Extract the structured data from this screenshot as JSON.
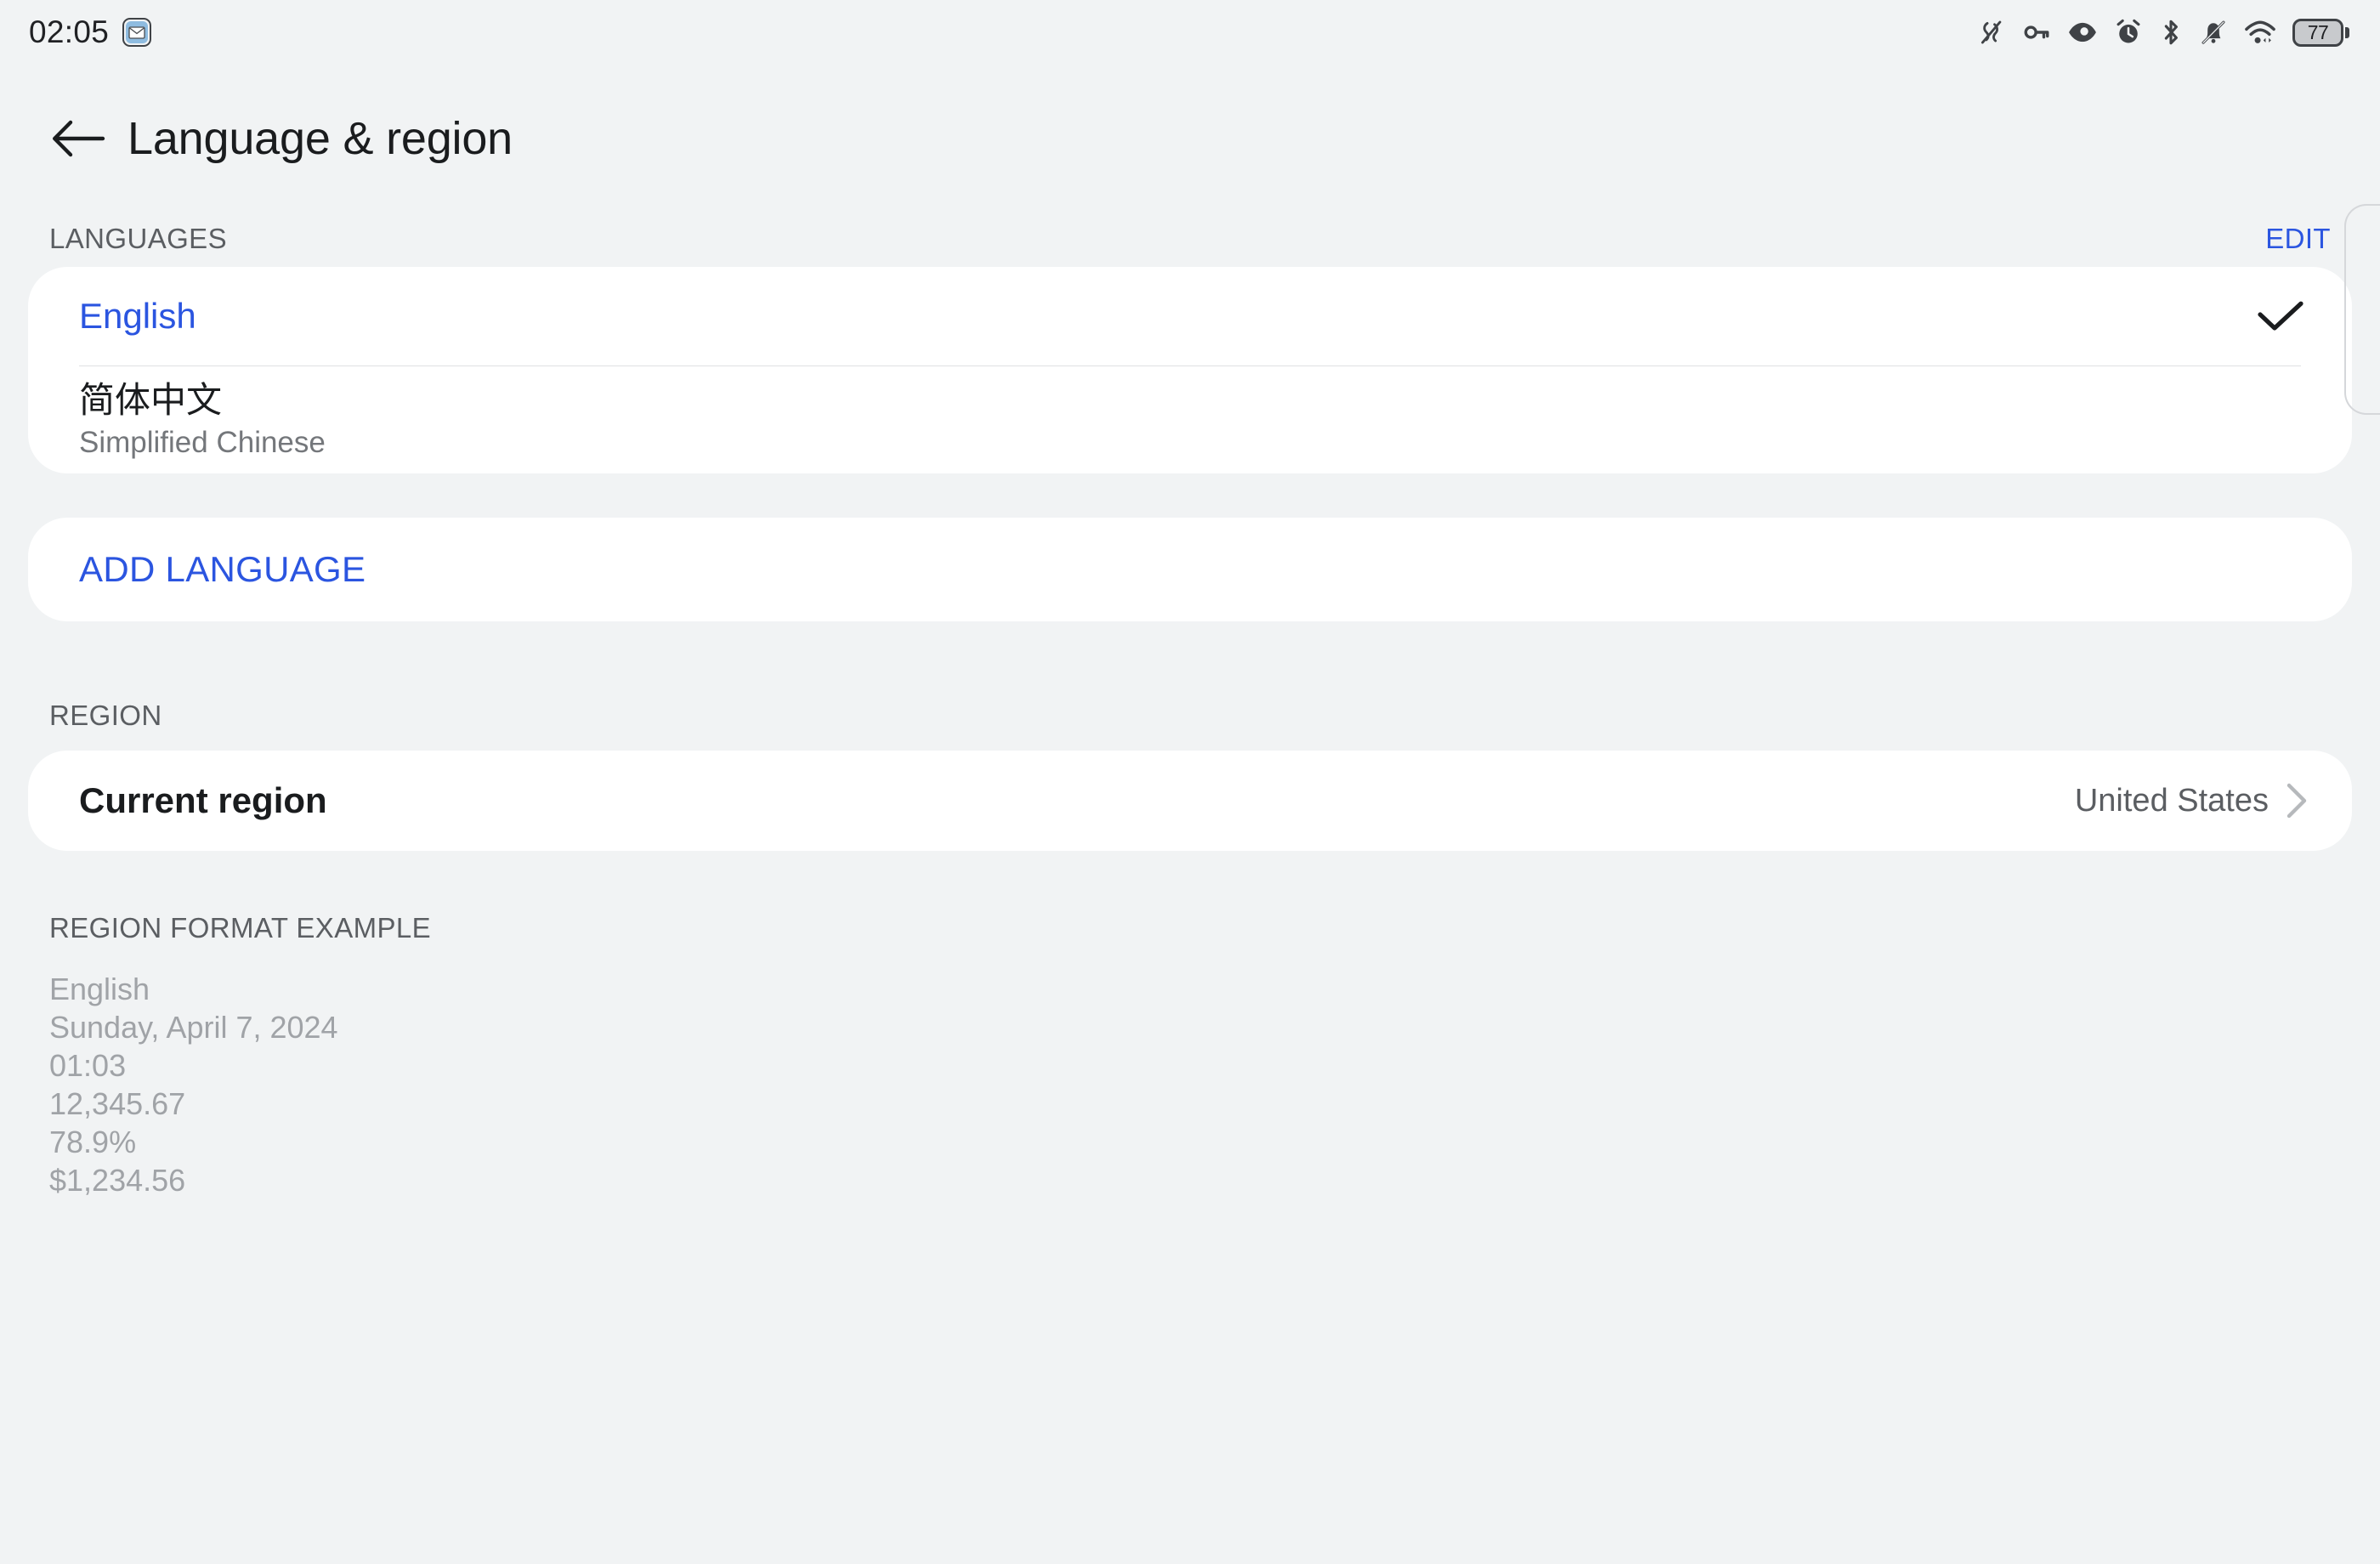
{
  "status_bar": {
    "time": "02:05",
    "notification_icon": "mail-envelope-icon",
    "icons": [
      "nfc-off-icon",
      "vpn-key-icon",
      "eye-comfort-icon",
      "alarm-clock-icon",
      "bluetooth-icon",
      "notifications-silenced-icon",
      "wifi-icon"
    ],
    "battery_level": "77"
  },
  "header": {
    "back_icon": "arrow-left-icon",
    "title": "Language & region"
  },
  "languages_section": {
    "label": "LANGUAGES",
    "edit_label": "EDIT",
    "items": [
      {
        "name": "English",
        "subtitle": "",
        "selected": true,
        "check_icon": "check-icon"
      },
      {
        "name": "简体中文",
        "subtitle": "Simplified Chinese",
        "selected": false
      }
    ],
    "add_language_label": "ADD LANGUAGE"
  },
  "region_section": {
    "label": "REGION",
    "row_title": "Current region",
    "row_value": "United States",
    "chevron_icon": "chevron-right-icon"
  },
  "format_section": {
    "label": "REGION FORMAT EXAMPLE",
    "lines": [
      "English",
      "Sunday, April 7, 2024",
      "01:03",
      "12,345.67",
      "78.9%",
      "$1,234.56"
    ]
  },
  "colors": {
    "accent_blue": "#2b55e0",
    "background": "#f1f3f4",
    "card": "#ffffff",
    "text_primary": "#1a1c1e",
    "text_secondary": "#5b5e62",
    "text_muted": "#a0a3a7"
  }
}
